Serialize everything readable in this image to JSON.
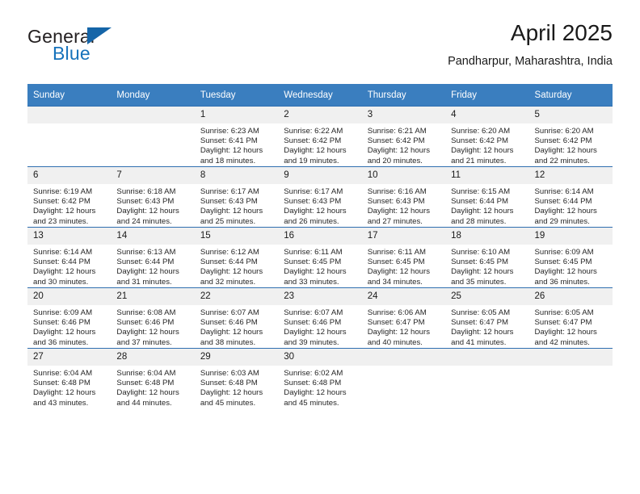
{
  "brand": {
    "name_top": "General",
    "name_bottom": "Blue",
    "accent_color": "#1672bb",
    "triangle_color": "#1565a8"
  },
  "header": {
    "title": "April 2025",
    "subtitle": "Pandharpur, Maharashtra, India"
  },
  "calendar": {
    "header_bg": "#3a7ebf",
    "row_divider_color": "#2f6fb0",
    "daynum_bg": "#f0f0f0",
    "weekday_headers": [
      "Sunday",
      "Monday",
      "Tuesday",
      "Wednesday",
      "Thursday",
      "Friday",
      "Saturday"
    ],
    "weeks": [
      [
        {
          "day": "",
          "sunrise": "",
          "sunset": "",
          "daylight_1": "",
          "daylight_2": ""
        },
        {
          "day": "",
          "sunrise": "",
          "sunset": "",
          "daylight_1": "",
          "daylight_2": ""
        },
        {
          "day": "1",
          "sunrise": "Sunrise: 6:23 AM",
          "sunset": "Sunset: 6:41 PM",
          "daylight_1": "Daylight: 12 hours",
          "daylight_2": "and 18 minutes."
        },
        {
          "day": "2",
          "sunrise": "Sunrise: 6:22 AM",
          "sunset": "Sunset: 6:42 PM",
          "daylight_1": "Daylight: 12 hours",
          "daylight_2": "and 19 minutes."
        },
        {
          "day": "3",
          "sunrise": "Sunrise: 6:21 AM",
          "sunset": "Sunset: 6:42 PM",
          "daylight_1": "Daylight: 12 hours",
          "daylight_2": "and 20 minutes."
        },
        {
          "day": "4",
          "sunrise": "Sunrise: 6:20 AM",
          "sunset": "Sunset: 6:42 PM",
          "daylight_1": "Daylight: 12 hours",
          "daylight_2": "and 21 minutes."
        },
        {
          "day": "5",
          "sunrise": "Sunrise: 6:20 AM",
          "sunset": "Sunset: 6:42 PM",
          "daylight_1": "Daylight: 12 hours",
          "daylight_2": "and 22 minutes."
        }
      ],
      [
        {
          "day": "6",
          "sunrise": "Sunrise: 6:19 AM",
          "sunset": "Sunset: 6:42 PM",
          "daylight_1": "Daylight: 12 hours",
          "daylight_2": "and 23 minutes."
        },
        {
          "day": "7",
          "sunrise": "Sunrise: 6:18 AM",
          "sunset": "Sunset: 6:43 PM",
          "daylight_1": "Daylight: 12 hours",
          "daylight_2": "and 24 minutes."
        },
        {
          "day": "8",
          "sunrise": "Sunrise: 6:17 AM",
          "sunset": "Sunset: 6:43 PM",
          "daylight_1": "Daylight: 12 hours",
          "daylight_2": "and 25 minutes."
        },
        {
          "day": "9",
          "sunrise": "Sunrise: 6:17 AM",
          "sunset": "Sunset: 6:43 PM",
          "daylight_1": "Daylight: 12 hours",
          "daylight_2": "and 26 minutes."
        },
        {
          "day": "10",
          "sunrise": "Sunrise: 6:16 AM",
          "sunset": "Sunset: 6:43 PM",
          "daylight_1": "Daylight: 12 hours",
          "daylight_2": "and 27 minutes."
        },
        {
          "day": "11",
          "sunrise": "Sunrise: 6:15 AM",
          "sunset": "Sunset: 6:44 PM",
          "daylight_1": "Daylight: 12 hours",
          "daylight_2": "and 28 minutes."
        },
        {
          "day": "12",
          "sunrise": "Sunrise: 6:14 AM",
          "sunset": "Sunset: 6:44 PM",
          "daylight_1": "Daylight: 12 hours",
          "daylight_2": "and 29 minutes."
        }
      ],
      [
        {
          "day": "13",
          "sunrise": "Sunrise: 6:14 AM",
          "sunset": "Sunset: 6:44 PM",
          "daylight_1": "Daylight: 12 hours",
          "daylight_2": "and 30 minutes."
        },
        {
          "day": "14",
          "sunrise": "Sunrise: 6:13 AM",
          "sunset": "Sunset: 6:44 PM",
          "daylight_1": "Daylight: 12 hours",
          "daylight_2": "and 31 minutes."
        },
        {
          "day": "15",
          "sunrise": "Sunrise: 6:12 AM",
          "sunset": "Sunset: 6:44 PM",
          "daylight_1": "Daylight: 12 hours",
          "daylight_2": "and 32 minutes."
        },
        {
          "day": "16",
          "sunrise": "Sunrise: 6:11 AM",
          "sunset": "Sunset: 6:45 PM",
          "daylight_1": "Daylight: 12 hours",
          "daylight_2": "and 33 minutes."
        },
        {
          "day": "17",
          "sunrise": "Sunrise: 6:11 AM",
          "sunset": "Sunset: 6:45 PM",
          "daylight_1": "Daylight: 12 hours",
          "daylight_2": "and 34 minutes."
        },
        {
          "day": "18",
          "sunrise": "Sunrise: 6:10 AM",
          "sunset": "Sunset: 6:45 PM",
          "daylight_1": "Daylight: 12 hours",
          "daylight_2": "and 35 minutes."
        },
        {
          "day": "19",
          "sunrise": "Sunrise: 6:09 AM",
          "sunset": "Sunset: 6:45 PM",
          "daylight_1": "Daylight: 12 hours",
          "daylight_2": "and 36 minutes."
        }
      ],
      [
        {
          "day": "20",
          "sunrise": "Sunrise: 6:09 AM",
          "sunset": "Sunset: 6:46 PM",
          "daylight_1": "Daylight: 12 hours",
          "daylight_2": "and 36 minutes."
        },
        {
          "day": "21",
          "sunrise": "Sunrise: 6:08 AM",
          "sunset": "Sunset: 6:46 PM",
          "daylight_1": "Daylight: 12 hours",
          "daylight_2": "and 37 minutes."
        },
        {
          "day": "22",
          "sunrise": "Sunrise: 6:07 AM",
          "sunset": "Sunset: 6:46 PM",
          "daylight_1": "Daylight: 12 hours",
          "daylight_2": "and 38 minutes."
        },
        {
          "day": "23",
          "sunrise": "Sunrise: 6:07 AM",
          "sunset": "Sunset: 6:46 PM",
          "daylight_1": "Daylight: 12 hours",
          "daylight_2": "and 39 minutes."
        },
        {
          "day": "24",
          "sunrise": "Sunrise: 6:06 AM",
          "sunset": "Sunset: 6:47 PM",
          "daylight_1": "Daylight: 12 hours",
          "daylight_2": "and 40 minutes."
        },
        {
          "day": "25",
          "sunrise": "Sunrise: 6:05 AM",
          "sunset": "Sunset: 6:47 PM",
          "daylight_1": "Daylight: 12 hours",
          "daylight_2": "and 41 minutes."
        },
        {
          "day": "26",
          "sunrise": "Sunrise: 6:05 AM",
          "sunset": "Sunset: 6:47 PM",
          "daylight_1": "Daylight: 12 hours",
          "daylight_2": "and 42 minutes."
        }
      ],
      [
        {
          "day": "27",
          "sunrise": "Sunrise: 6:04 AM",
          "sunset": "Sunset: 6:48 PM",
          "daylight_1": "Daylight: 12 hours",
          "daylight_2": "and 43 minutes."
        },
        {
          "day": "28",
          "sunrise": "Sunrise: 6:04 AM",
          "sunset": "Sunset: 6:48 PM",
          "daylight_1": "Daylight: 12 hours",
          "daylight_2": "and 44 minutes."
        },
        {
          "day": "29",
          "sunrise": "Sunrise: 6:03 AM",
          "sunset": "Sunset: 6:48 PM",
          "daylight_1": "Daylight: 12 hours",
          "daylight_2": "and 45 minutes."
        },
        {
          "day": "30",
          "sunrise": "Sunrise: 6:02 AM",
          "sunset": "Sunset: 6:48 PM",
          "daylight_1": "Daylight: 12 hours",
          "daylight_2": "and 45 minutes."
        },
        {
          "day": "",
          "sunrise": "",
          "sunset": "",
          "daylight_1": "",
          "daylight_2": ""
        },
        {
          "day": "",
          "sunrise": "",
          "sunset": "",
          "daylight_1": "",
          "daylight_2": ""
        },
        {
          "day": "",
          "sunrise": "",
          "sunset": "",
          "daylight_1": "",
          "daylight_2": ""
        }
      ]
    ]
  }
}
